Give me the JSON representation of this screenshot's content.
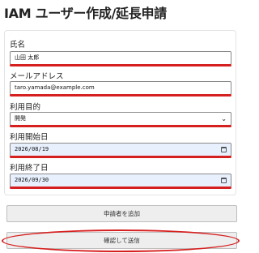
{
  "page": {
    "title": "IAM ユーザー作成/延長申請"
  },
  "form": {
    "name": {
      "label": "氏名",
      "value": "山田 太郎"
    },
    "email": {
      "label": "メールアドレス",
      "value": "taro.yamada@example.com"
    },
    "purpose": {
      "label": "利用目的",
      "selected": "開発"
    },
    "start_date": {
      "label": "利用開始日",
      "value": "2026/08/19"
    },
    "end_date": {
      "label": "利用終了日",
      "value": "2026/09/30"
    }
  },
  "buttons": {
    "add_applicant": "申請者を追加",
    "confirm_send": "確認して送信"
  },
  "icons": {
    "date": "calendar-icon",
    "select": "chevron-down-icon"
  },
  "colors": {
    "annotation_red": "#d6201f",
    "date_field_bg": "#e8f0fe"
  }
}
